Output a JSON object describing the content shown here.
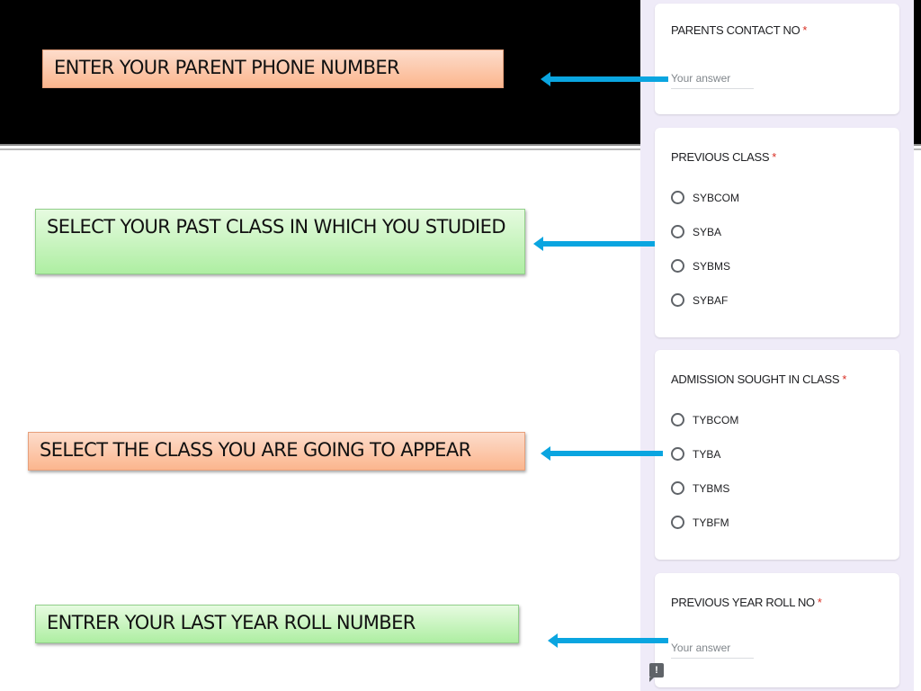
{
  "callouts": {
    "parent_phone": "ENTER YOUR PARENT PHONE NUMBER",
    "past_class": "SELECT YOUR PAST  CLASS IN WHICH YOU STUDIED",
    "appear_class": "SELECT THE CLASS YOU ARE GOING TO APPEAR",
    "roll_number": "ENTRER YOUR LAST YEAR ROLL NUMBER"
  },
  "form": {
    "required_marker": "*",
    "parents_contact": {
      "title": "PARENTS CONTACT NO",
      "placeholder": "Your answer"
    },
    "previous_class": {
      "title": "PREVIOUS CLASS",
      "options": [
        "SYBCOM",
        "SYBA",
        "SYBMS",
        "SYBAF"
      ]
    },
    "admission_class": {
      "title": "ADMISSION SOUGHT IN CLASS",
      "options": [
        "TYBCOM",
        "TYBA",
        "TYBMS",
        "TYBFM"
      ]
    },
    "roll_no": {
      "title": "PREVIOUS YEAR ROLL NO",
      "placeholder": "Your answer"
    }
  },
  "feedback_icon_glyph": "!",
  "colors": {
    "arrow": "#0aa5e0",
    "peach_callout": "#fbb68e",
    "green_callout": "#aeeea2",
    "required": "#d93025",
    "form_background": "#efebf8"
  }
}
